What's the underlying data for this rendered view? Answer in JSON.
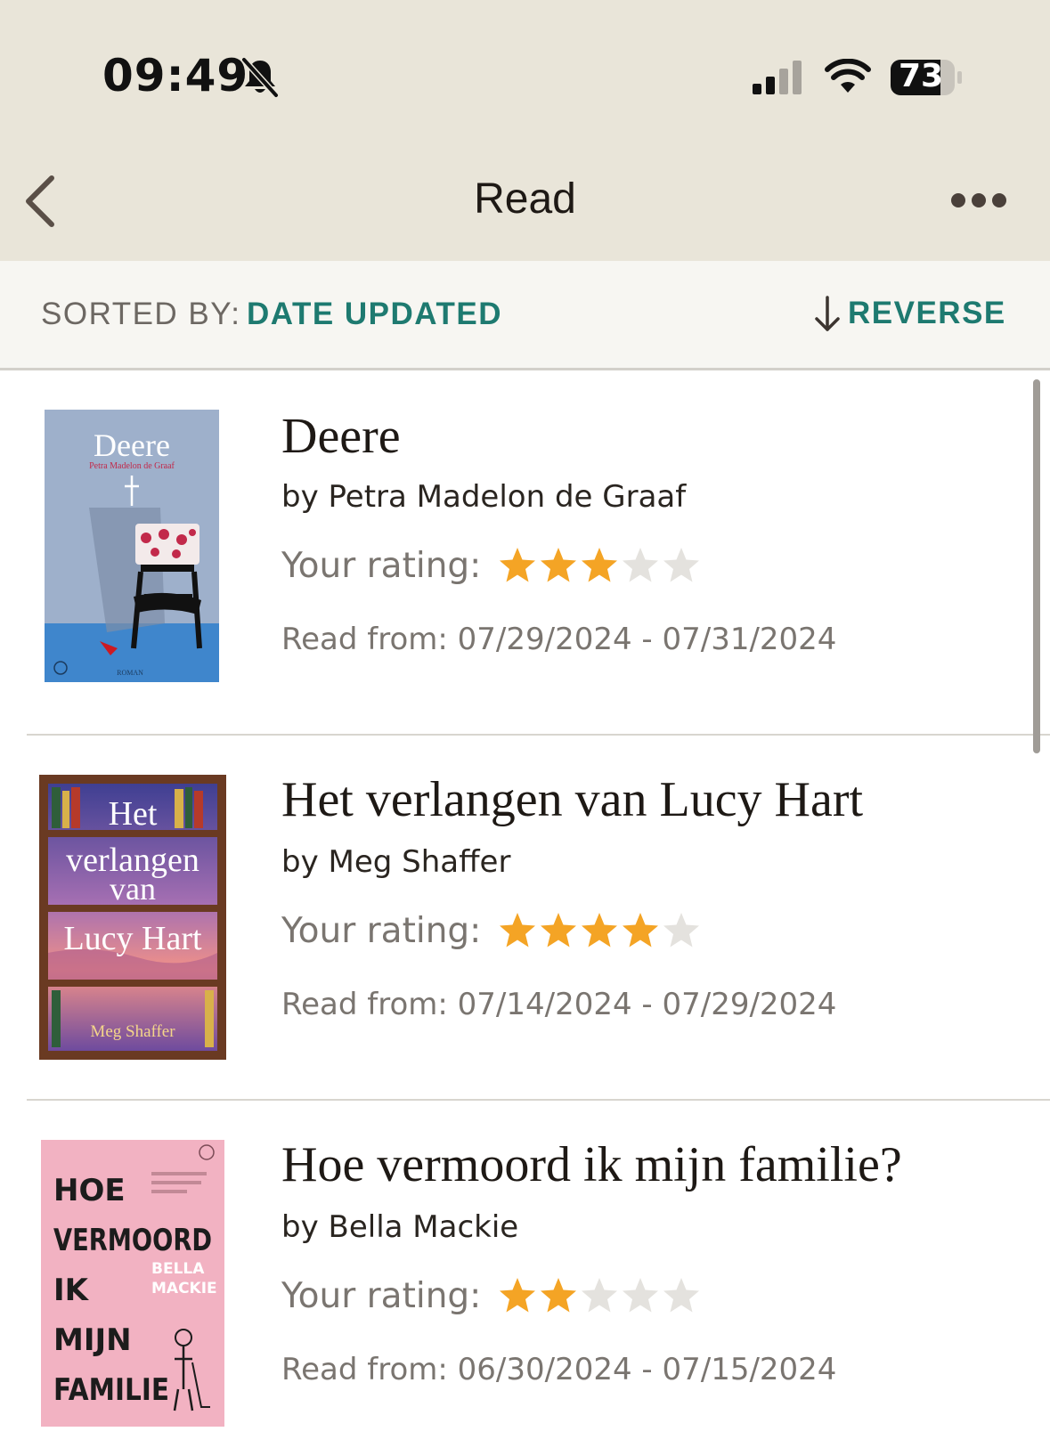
{
  "status_bar": {
    "time": "09:49",
    "battery": "73",
    "icons": [
      "bell-slash-icon",
      "cellular-signal-icon",
      "wifi-icon",
      "battery-icon"
    ]
  },
  "nav": {
    "title": "Read",
    "back_icon": "chevron-left-icon",
    "more_icon": "ellipsis-icon"
  },
  "sort": {
    "label": "SORTED BY:",
    "value": "DATE UPDATED",
    "reverse_label": "REVERSE",
    "reverse_icon": "arrow-down-icon"
  },
  "colors": {
    "topbar_bg": "#e9e5d9",
    "sortbar_bg": "#f7f6f2",
    "accent": "#1e7a70",
    "star_filled": "#f4a425",
    "star_empty": "#e4e2de"
  },
  "rating_label": "Your rating:",
  "books": [
    {
      "title": "Deere",
      "author": "by Petra Madelon de Graaf",
      "rating": 3,
      "max_rating": 5,
      "read_dates": "Read from: 07/29/2024 - 07/31/2024",
      "cover": {
        "title": "Deere",
        "author": "Petra Madelon de Graaf",
        "footer": "ROMAN"
      }
    },
    {
      "title": "Het verlangen van Lucy Hart",
      "author": "by Meg Shaffer",
      "rating": 4,
      "max_rating": 5,
      "read_dates": "Read from: 07/14/2024 - 07/29/2024",
      "cover": {
        "line1": "Het",
        "line2": "verlangen",
        "line3": "van",
        "line4": "Lucy Hart",
        "author": "Meg Shaffer"
      }
    },
    {
      "title": "Hoe vermoord ik mijn familie?",
      "author": "by Bella Mackie",
      "rating": 2,
      "max_rating": 5,
      "read_dates": "Read from: 06/30/2024 - 07/15/2024",
      "cover": {
        "line1": "HOE",
        "line2": "VERMOORD",
        "line3": "IK",
        "line4": "MIJN",
        "line5": "FAMILIE",
        "author1": "BELLA",
        "author2": "MACKIE"
      }
    }
  ]
}
